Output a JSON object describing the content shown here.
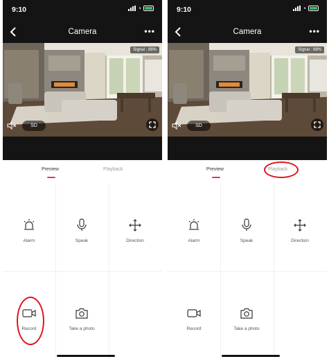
{
  "screens": [
    {
      "status": {
        "time": "9:10"
      },
      "nav": {
        "title": "Camera"
      },
      "video": {
        "signal": "Signal : 88%",
        "quality": "SD"
      },
      "tabs": {
        "preview": "Preview",
        "playback": "Playback"
      },
      "actions": [
        {
          "label": "Alarm",
          "icon": "alarm-icon"
        },
        {
          "label": "Speak",
          "icon": "microphone-icon"
        },
        {
          "label": "Direction",
          "icon": "direction-icon"
        },
        {
          "label": "Record",
          "icon": "record-icon"
        },
        {
          "label": "Take a photo",
          "icon": "camera-icon"
        }
      ],
      "highlight": "Record"
    },
    {
      "status": {
        "time": "9:10"
      },
      "nav": {
        "title": "Camera"
      },
      "video": {
        "signal": "Signal : 88%",
        "quality": "SD"
      },
      "tabs": {
        "preview": "Preview",
        "playback": "Playback"
      },
      "actions": [
        {
          "label": "Alarm",
          "icon": "alarm-icon"
        },
        {
          "label": "Speak",
          "icon": "microphone-icon"
        },
        {
          "label": "Direction",
          "icon": "direction-icon"
        },
        {
          "label": "Record",
          "icon": "record-icon"
        },
        {
          "label": "Take a photo",
          "icon": "camera-icon"
        }
      ],
      "highlight": "Playback"
    }
  ],
  "colors": {
    "accent": "#e8355a",
    "annotation": "#e0121d",
    "battery": "#33c05a"
  }
}
